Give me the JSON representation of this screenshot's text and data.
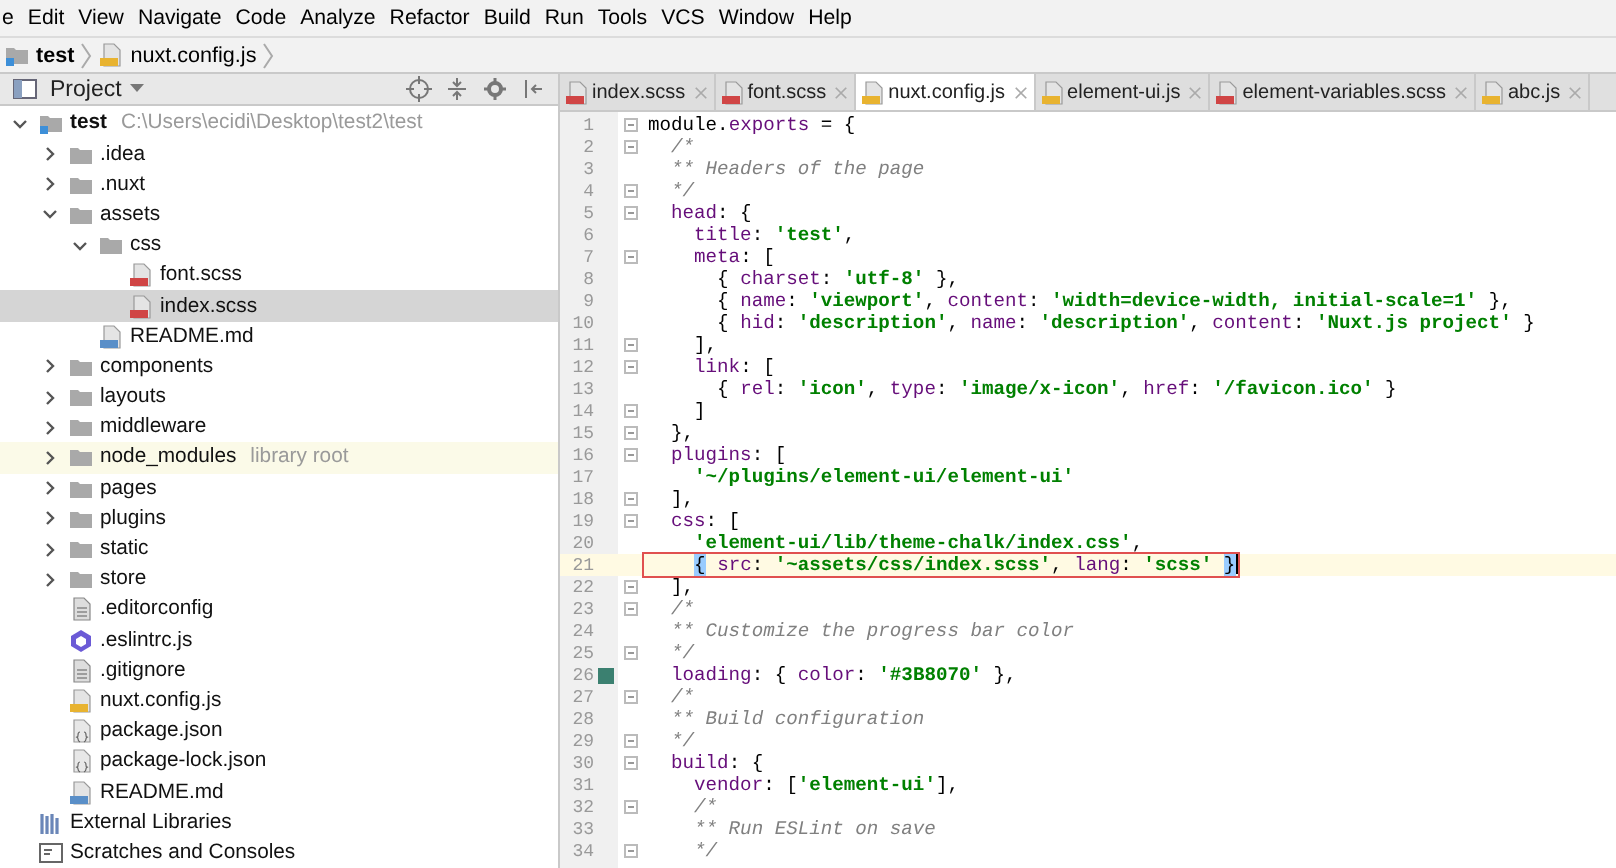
{
  "menu": [
    "e",
    "Edit",
    "View",
    "Navigate",
    "Code",
    "Analyze",
    "Refactor",
    "Build",
    "Run",
    "Tools",
    "VCS",
    "Window",
    "Help"
  ],
  "breadcrumb": [
    {
      "label": "test",
      "kind": "project"
    },
    {
      "label": "nuxt.config.js",
      "kind": "js"
    }
  ],
  "project_panel": {
    "title": "Project",
    "tree": [
      {
        "name": "test",
        "hint": "C:\\Users\\ecidi\\Desktop\\test2\\test",
        "kind": "project",
        "expanded": true,
        "selected": false,
        "children": [
          {
            "name": ".idea",
            "kind": "folder",
            "expanded": false,
            "selected": false
          },
          {
            "name": ".nuxt",
            "kind": "folder",
            "expanded": false,
            "selected": false
          },
          {
            "name": "assets",
            "kind": "folder",
            "expanded": true,
            "selected": false,
            "children": [
              {
                "name": "css",
                "kind": "folder",
                "expanded": true,
                "selected": false,
                "children": [
                  {
                    "name": "font.scss",
                    "kind": "sass",
                    "selected": false
                  },
                  {
                    "name": "index.scss",
                    "kind": "sass",
                    "selected": true
                  }
                ]
              },
              {
                "name": "README.md",
                "kind": "md",
                "selected": false
              }
            ]
          },
          {
            "name": "components",
            "kind": "folder",
            "expanded": false,
            "selected": false
          },
          {
            "name": "layouts",
            "kind": "folder",
            "expanded": false,
            "selected": false
          },
          {
            "name": "middleware",
            "kind": "folder",
            "expanded": false,
            "selected": false
          },
          {
            "name": "node_modules",
            "hint": "library root",
            "kind": "library_folder",
            "expanded": false,
            "selected": false
          },
          {
            "name": "pages",
            "kind": "folder",
            "expanded": false,
            "selected": false
          },
          {
            "name": "plugins",
            "kind": "folder",
            "expanded": false,
            "selected": false
          },
          {
            "name": "static",
            "kind": "folder",
            "expanded": false,
            "selected": false
          },
          {
            "name": "store",
            "kind": "folder",
            "expanded": false,
            "selected": false
          },
          {
            "name": ".editorconfig",
            "kind": "text",
            "selected": false
          },
          {
            "name": ".eslintrc.js",
            "kind": "eslint",
            "selected": false
          },
          {
            "name": ".gitignore",
            "kind": "text",
            "selected": false
          },
          {
            "name": "nuxt.config.js",
            "kind": "js",
            "selected": false
          },
          {
            "name": "package.json",
            "kind": "json",
            "selected": false
          },
          {
            "name": "package-lock.json",
            "kind": "json",
            "selected": false
          },
          {
            "name": "README.md",
            "kind": "md",
            "selected": false
          }
        ]
      },
      {
        "name": "External Libraries",
        "kind": "libraries",
        "selected": false
      },
      {
        "name": "Scratches and Consoles",
        "kind": "scratches",
        "selected": false
      }
    ]
  },
  "tabs": [
    {
      "label": "index.scss",
      "kind": "sass",
      "selected": false
    },
    {
      "label": "font.scss",
      "kind": "sass",
      "selected": false
    },
    {
      "label": "nuxt.config.js",
      "kind": "js",
      "selected": true
    },
    {
      "label": "element-ui.js",
      "kind": "js",
      "selected": false
    },
    {
      "label": "element-variables.scss",
      "kind": "sass",
      "selected": false
    },
    {
      "label": "abc.js",
      "kind": "js",
      "selected": false
    }
  ],
  "code": [
    {
      "number": "1",
      "fold": true,
      "tokens": [
        {
          "kind": "text",
          "text": "module."
        },
        {
          "kind": "key",
          "text": "exports"
        },
        {
          "kind": "text",
          "text": " = {"
        }
      ]
    },
    {
      "number": "2",
      "fold": true,
      "tokens": [
        {
          "kind": "comment",
          "text": "  /*"
        }
      ]
    },
    {
      "number": "3",
      "tokens": [
        {
          "kind": "comment",
          "text": "  ** Headers of the page"
        }
      ]
    },
    {
      "number": "4",
      "fold": true,
      "tokens": [
        {
          "kind": "comment",
          "text": "  */"
        }
      ]
    },
    {
      "number": "5",
      "fold": true,
      "tokens": [
        {
          "kind": "key",
          "text": "  head"
        },
        {
          "kind": "text",
          "text": ": {"
        }
      ]
    },
    {
      "number": "6",
      "tokens": [
        {
          "kind": "key",
          "text": "    title"
        },
        {
          "kind": "text",
          "text": ": "
        },
        {
          "kind": "string",
          "text": "'test'"
        },
        {
          "kind": "text",
          "text": ","
        }
      ]
    },
    {
      "number": "7",
      "fold": true,
      "tokens": [
        {
          "kind": "key",
          "text": "    meta"
        },
        {
          "kind": "text",
          "text": ": ["
        }
      ]
    },
    {
      "number": "8",
      "tokens": [
        {
          "kind": "text",
          "text": "      { "
        },
        {
          "kind": "key",
          "text": "charset"
        },
        {
          "kind": "text",
          "text": ": "
        },
        {
          "kind": "string",
          "text": "'utf-8'"
        },
        {
          "kind": "text",
          "text": " },"
        }
      ]
    },
    {
      "number": "9",
      "tokens": [
        {
          "kind": "text",
          "text": "      { "
        },
        {
          "kind": "key",
          "text": "name"
        },
        {
          "kind": "text",
          "text": ": "
        },
        {
          "kind": "string",
          "text": "'viewport'"
        },
        {
          "kind": "text",
          "text": ", "
        },
        {
          "kind": "key",
          "text": "content"
        },
        {
          "kind": "text",
          "text": ": "
        },
        {
          "kind": "string",
          "text": "'width=device-width, initial-scale=1'"
        },
        {
          "kind": "text",
          "text": " },"
        }
      ]
    },
    {
      "number": "10",
      "tokens": [
        {
          "kind": "text",
          "text": "      { "
        },
        {
          "kind": "key",
          "text": "hid"
        },
        {
          "kind": "text",
          "text": ": "
        },
        {
          "kind": "string",
          "text": "'description'"
        },
        {
          "kind": "text",
          "text": ", "
        },
        {
          "kind": "key",
          "text": "name"
        },
        {
          "kind": "text",
          "text": ": "
        },
        {
          "kind": "string",
          "text": "'description'"
        },
        {
          "kind": "text",
          "text": ", "
        },
        {
          "kind": "key",
          "text": "content"
        },
        {
          "kind": "text",
          "text": ": "
        },
        {
          "kind": "string",
          "text": "'Nuxt.js project'"
        },
        {
          "kind": "text",
          "text": " }"
        }
      ]
    },
    {
      "number": "11",
      "fold": true,
      "tokens": [
        {
          "kind": "text",
          "text": "    ],"
        }
      ]
    },
    {
      "number": "12",
      "fold": true,
      "tokens": [
        {
          "kind": "key",
          "text": "    link"
        },
        {
          "kind": "text",
          "text": ": ["
        }
      ]
    },
    {
      "number": "13",
      "tokens": [
        {
          "kind": "text",
          "text": "      { "
        },
        {
          "kind": "key",
          "text": "rel"
        },
        {
          "kind": "text",
          "text": ": "
        },
        {
          "kind": "string",
          "text": "'icon'"
        },
        {
          "kind": "text",
          "text": ", "
        },
        {
          "kind": "key",
          "text": "type"
        },
        {
          "kind": "text",
          "text": ": "
        },
        {
          "kind": "string",
          "text": "'image/x-icon'"
        },
        {
          "kind": "text",
          "text": ", "
        },
        {
          "kind": "key",
          "text": "href"
        },
        {
          "kind": "text",
          "text": ": "
        },
        {
          "kind": "string",
          "text": "'/favicon.ico'"
        },
        {
          "kind": "text",
          "text": " }"
        }
      ]
    },
    {
      "number": "14",
      "fold": true,
      "tokens": [
        {
          "kind": "text",
          "text": "    ]"
        }
      ]
    },
    {
      "number": "15",
      "fold": true,
      "tokens": [
        {
          "kind": "text",
          "text": "  },"
        }
      ]
    },
    {
      "number": "16",
      "fold": true,
      "tokens": [
        {
          "kind": "key",
          "text": "  plugins"
        },
        {
          "kind": "text",
          "text": ": ["
        }
      ]
    },
    {
      "number": "17",
      "tokens": [
        {
          "kind": "string",
          "text": "    '~/plugins/element-ui/element-ui'"
        }
      ]
    },
    {
      "number": "18",
      "fold": true,
      "tokens": [
        {
          "kind": "text",
          "text": "  ],"
        }
      ]
    },
    {
      "number": "19",
      "fold": true,
      "tokens": [
        {
          "kind": "key",
          "text": "  css"
        },
        {
          "kind": "text",
          "text": ": ["
        }
      ]
    },
    {
      "number": "20",
      "tokens": [
        {
          "kind": "string",
          "text": "    'element-ui/lib/theme-chalk/index.css'"
        },
        {
          "kind": "text",
          "text": ","
        }
      ]
    },
    {
      "number": "21",
      "current": true,
      "boxed": true,
      "tokens": [
        {
          "kind": "brace",
          "text": "    {"
        },
        {
          "kind": "key",
          "text": " src"
        },
        {
          "kind": "text",
          "text": ": "
        },
        {
          "kind": "string",
          "text": "'~assets/css/index.scss'"
        },
        {
          "kind": "text",
          "text": ", "
        },
        {
          "kind": "key",
          "text": "lang"
        },
        {
          "kind": "text",
          "text": ": "
        },
        {
          "kind": "string",
          "text": "'scss'"
        },
        {
          "kind": "brace",
          "text": " }"
        }
      ]
    },
    {
      "number": "22",
      "fold": true,
      "tokens": [
        {
          "kind": "text",
          "text": "  ],"
        }
      ]
    },
    {
      "number": "23",
      "fold": true,
      "tokens": [
        {
          "kind": "comment",
          "text": "  /*"
        }
      ]
    },
    {
      "number": "24",
      "tokens": [
        {
          "kind": "comment",
          "text": "  ** Customize the progress bar color"
        }
      ]
    },
    {
      "number": "25",
      "fold": true,
      "tokens": [
        {
          "kind": "comment",
          "text": "  */"
        }
      ]
    },
    {
      "number": "26",
      "color": "#3b8070",
      "tokens": [
        {
          "kind": "key",
          "text": "  loading"
        },
        {
          "kind": "text",
          "text": ": { "
        },
        {
          "kind": "key",
          "text": "color"
        },
        {
          "kind": "text",
          "text": ": "
        },
        {
          "kind": "string",
          "text": "'#3B8070'"
        },
        {
          "kind": "text",
          "text": " },"
        }
      ]
    },
    {
      "number": "27",
      "fold": true,
      "tokens": [
        {
          "kind": "comment",
          "text": "  /*"
        }
      ]
    },
    {
      "number": "28",
      "tokens": [
        {
          "kind": "comment",
          "text": "  ** Build configuration"
        }
      ]
    },
    {
      "number": "29",
      "fold": true,
      "tokens": [
        {
          "kind": "comment",
          "text": "  */"
        }
      ]
    },
    {
      "number": "30",
      "fold": true,
      "tokens": [
        {
          "kind": "key",
          "text": "  build"
        },
        {
          "kind": "text",
          "text": ": {"
        }
      ]
    },
    {
      "number": "31",
      "tokens": [
        {
          "kind": "key",
          "text": "    vendor"
        },
        {
          "kind": "text",
          "text": ": ["
        },
        {
          "kind": "string",
          "text": "'element-ui'"
        },
        {
          "kind": "text",
          "text": "],"
        }
      ]
    },
    {
      "number": "32",
      "fold": true,
      "tokens": [
        {
          "kind": "comment",
          "text": "    /*"
        }
      ]
    },
    {
      "number": "33",
      "tokens": [
        {
          "kind": "comment",
          "text": "    ** Run ESLint on save"
        }
      ]
    },
    {
      "number": "34",
      "fold": true,
      "tokens": [
        {
          "kind": "comment",
          "text": "    */"
        }
      ]
    }
  ]
}
